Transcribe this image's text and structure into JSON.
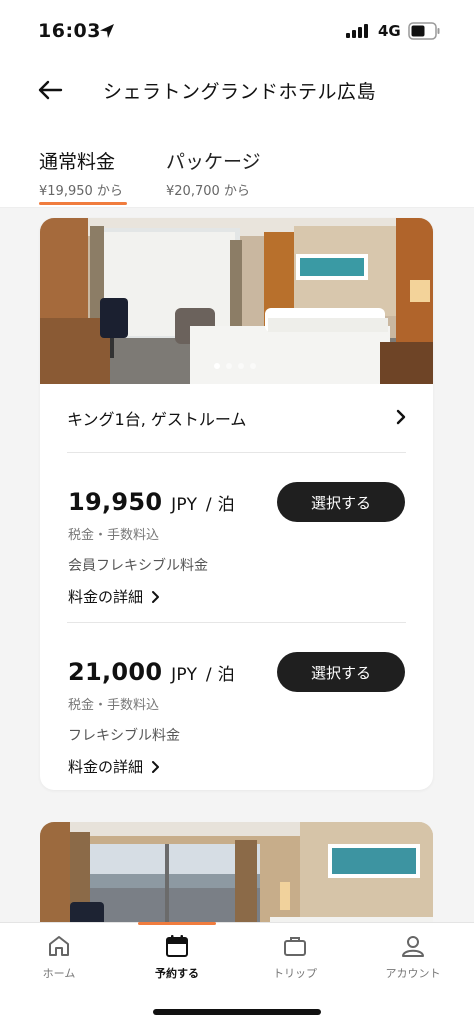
{
  "status_bar": {
    "time": "16:03",
    "network": "4G"
  },
  "header": {
    "title": "シェラトングランドホテル広島"
  },
  "tabs": [
    {
      "label": "通常料金",
      "price": "¥19,950 から",
      "active": true
    },
    {
      "label": "パッケージ",
      "price": "¥20,700 から",
      "active": false
    }
  ],
  "room": {
    "name": "キング1台, ゲストルーム",
    "photo_pages": 4,
    "active_photo_index": 0,
    "rates": [
      {
        "amount": "19,950",
        "currency": "JPY",
        "per": "/ 泊",
        "tax_note": "税金・手数料込",
        "plan": "会員フレキシブル料金",
        "details_label": "料金の詳細",
        "button": "選択する"
      },
      {
        "amount": "21,000",
        "currency": "JPY",
        "per": "/ 泊",
        "tax_note": "税金・手数料込",
        "plan": "フレキシブル料金",
        "details_label": "料金の詳細",
        "button": "選択する"
      }
    ]
  },
  "tabbar": {
    "items": [
      {
        "label": "ホーム",
        "icon": "home-icon",
        "active": false
      },
      {
        "label": "予約する",
        "icon": "calendar-icon",
        "active": true
      },
      {
        "label": "トリップ",
        "icon": "suitcase-icon",
        "active": false
      },
      {
        "label": "アカウント",
        "icon": "person-icon",
        "active": false
      }
    ]
  },
  "colors": {
    "accent": "#f07c3e",
    "button": "#1f1f1f",
    "background": "#f4f4f4"
  }
}
